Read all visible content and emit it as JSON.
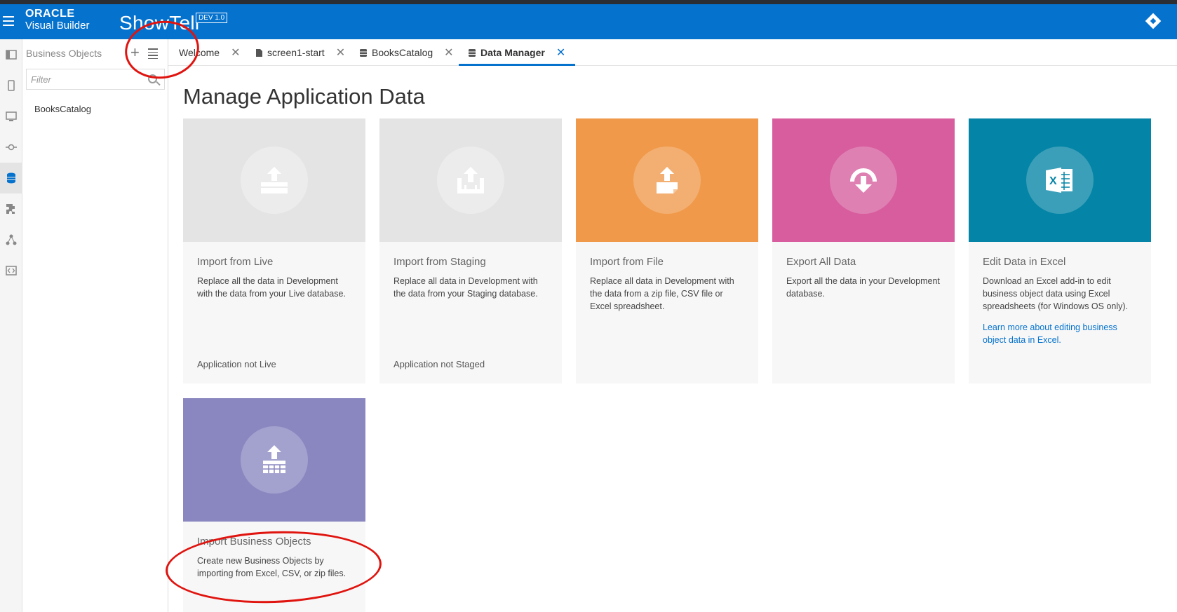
{
  "header": {
    "brand_line1": "ORACLE",
    "brand_line2": "Visual Builder",
    "app_name": "ShowTell",
    "version_badge": "DEV 1.0"
  },
  "sidebar": {
    "title": "Business Objects",
    "filter_placeholder": "Filter",
    "items": [
      {
        "label": "BooksCatalog"
      }
    ]
  },
  "tabs": [
    {
      "label": "Welcome",
      "icon": "none",
      "active": false
    },
    {
      "label": "screen1-start",
      "icon": "file-icon",
      "active": false
    },
    {
      "label": "BooksCatalog",
      "icon": "database-icon",
      "active": false
    },
    {
      "label": "Data Manager",
      "icon": "database-icon",
      "active": true
    }
  ],
  "main": {
    "title": "Manage Application Data",
    "cards": [
      {
        "title": "Import from Live",
        "description": "Replace all the data in Development with the data from your Live database.",
        "footer": "Application not Live",
        "icon": "upload-tray-icon",
        "color": "#e4e4e4"
      },
      {
        "title": "Import from Staging",
        "description": "Replace all data in Development with the data from your Staging database.",
        "footer": "Application not Staged",
        "icon": "upload-box-icon",
        "color": "#e4e4e4"
      },
      {
        "title": "Import from File",
        "description": "Replace all data in Development with the data from a zip file, CSV file or Excel spreadsheet.",
        "icon": "upload-file-icon",
        "color": "#f0994a"
      },
      {
        "title": "Export All Data",
        "description": "Export all the data in your Development database.",
        "icon": "download-arc-icon",
        "color": "#d75d9e"
      },
      {
        "title": "Edit Data in Excel",
        "description": "Download an Excel add-in to edit business object data using Excel spreadsheets (for Windows OS only).",
        "link": "Learn more about editing business object data in Excel.",
        "icon": "excel-icon",
        "color": "#0484a6"
      },
      {
        "title": "Import Business Objects",
        "description": "Create new Business Objects by importing from Excel, CSV, or zip files.",
        "icon": "upload-grid-icon",
        "color": "#8a87c0"
      }
    ]
  },
  "colors": {
    "brand_blue": "#0572ce",
    "annotation_red": "#e0140f"
  }
}
